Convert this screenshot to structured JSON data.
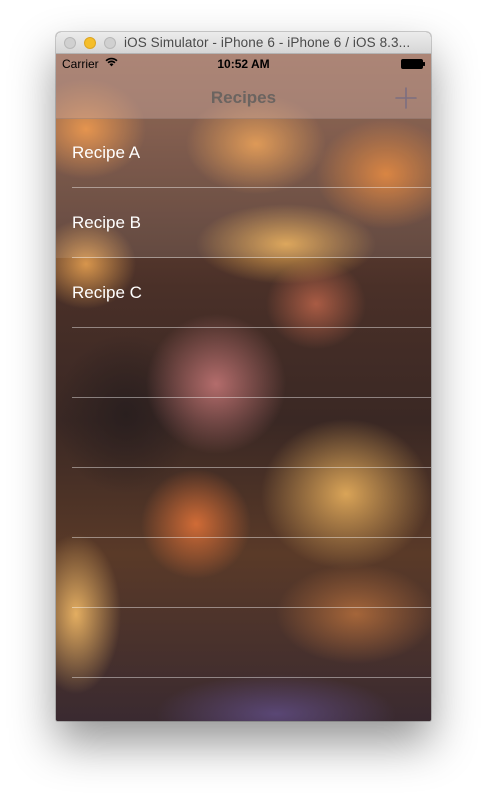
{
  "window": {
    "title": "iOS Simulator - iPhone 6 - iPhone 6 / iOS 8.3..."
  },
  "status_bar": {
    "carrier": "Carrier",
    "time": "10:52 AM",
    "icons": [
      "wifi-icon",
      "battery-icon"
    ]
  },
  "nav_bar": {
    "title": "Recipes",
    "right_icon": "plus-icon"
  },
  "recipes": [
    {
      "label": "Recipe A"
    },
    {
      "label": "Recipe B"
    },
    {
      "label": "Recipe C"
    }
  ],
  "colors": {
    "nav_title": "#6b6460",
    "nav_tint": "#7c6e80",
    "cell_text": "#ffffff",
    "minimize_button": "#f5be2a"
  }
}
